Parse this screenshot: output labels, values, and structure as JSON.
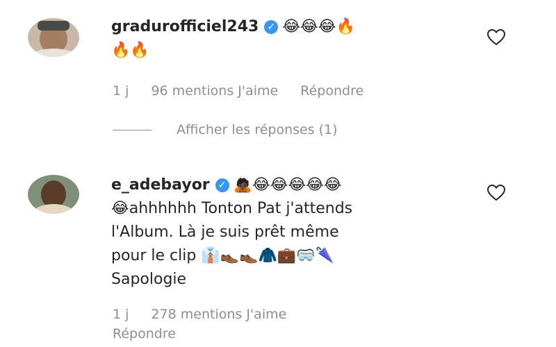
{
  "comment1": {
    "username": "gradurofficiel243",
    "line1_emojis": "😂😂😂🔥",
    "line2_emojis": "🔥🔥",
    "time": "1 j",
    "likes": "96 mentions J'aime",
    "reply": "Répondre",
    "view_replies": "Afficher les réponses (1)"
  },
  "comment2": {
    "username": "e_adebayor",
    "line1_emojis": "🙇🏿😂😂😂😂😂",
    "line2": "😂ahhhhhh Tonton Pat j'attends",
    "line3": "l'Album. Là je suis prêt même",
    "line4": "pour le clip 👔👞👞🧥💼🥽🌂",
    "line5": "Sapologie",
    "time": "1 j",
    "likes": "278 mentions J'aime",
    "reply": "Répondre"
  },
  "icons": {
    "verified": "verified-badge-icon",
    "like": "heart-outline-icon"
  },
  "colors": {
    "text": "#262626",
    "muted": "#8e8e8e",
    "verified": "#3897f0"
  }
}
